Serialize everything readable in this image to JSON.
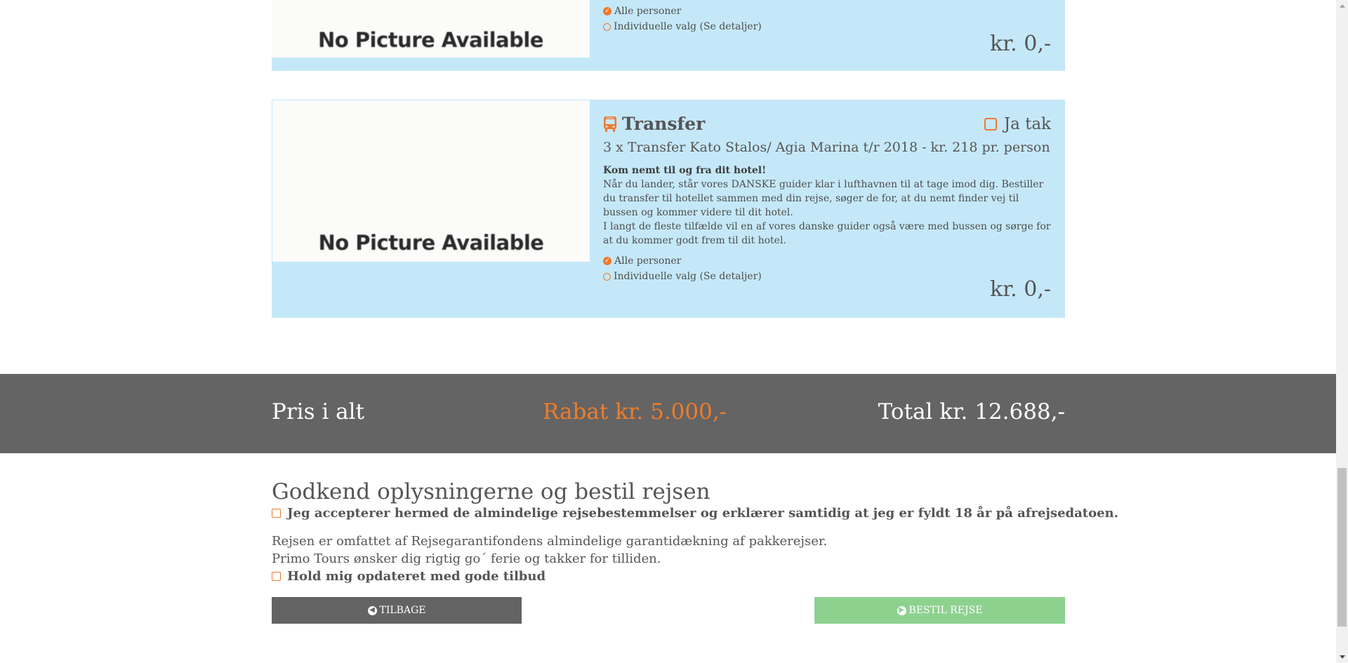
{
  "card_top": {
    "image_text": "No Picture Available",
    "options": [
      {
        "label": "Alle personer",
        "selected": true
      },
      {
        "label": "Individuelle valg (Se detaljer)",
        "selected": false
      }
    ],
    "price": "kr. 0,-"
  },
  "card_transfer": {
    "title": "Transfer",
    "icon": "bus-icon",
    "toggle_label": "Ja tak",
    "subtitle": "3 x Transfer Kato Stalos/ Agia Marina t/r 2018 - kr. 218 pr. person",
    "desc_heading": "Kom nemt til og fra dit hotel!",
    "desc_p1": "Når du lander, står vores DANSKE guider klar i lufthavnen til at tage imod dig. Bestiller du transfer til hotellet sammen med din rejse, søger de for, at du nemt finder vej til bussen og kommer videre til dit hotel.",
    "desc_p2": "I langt de fleste tilfælde vil en af vores danske guider også være med bussen og sørge for at du kommer godt frem til dit hotel.",
    "image_text": "No Picture Available",
    "options": [
      {
        "label": "Alle personer",
        "selected": true
      },
      {
        "label": "Individuelle valg (Se detaljer)",
        "selected": false
      }
    ],
    "price": "kr. 0,-"
  },
  "total_bar": {
    "label": "Pris i alt",
    "rabat": "Rabat kr. 5.000,-",
    "total": "Total kr. 12.688,-"
  },
  "approve": {
    "title": "Godkend oplysningerne og bestil rejsen",
    "terms_label": "Jeg accepterer hermed de almindelige rejsebestemmelser og erklærer samtidig at jeg er fyldt 18 år på afrejsedatoen.",
    "guarantee_text": "Rejsen er omfattet af Rejsegarantifondens almindelige garantidækning af pakkerejser.",
    "thanks_text": "Primo Tours ønsker dig rigtig go´ ferie og takker for tilliden.",
    "newsletter_label": "Hold mig opdateret med gode tilbud"
  },
  "buttons": {
    "back_label": "TILBAGE",
    "order_label": "BESTIL REJSE"
  },
  "colors": {
    "accent": "#ee7a2e",
    "card_bg": "#c5e8f8",
    "bar_bg": "#646464",
    "order_button": "#8ed18f"
  }
}
